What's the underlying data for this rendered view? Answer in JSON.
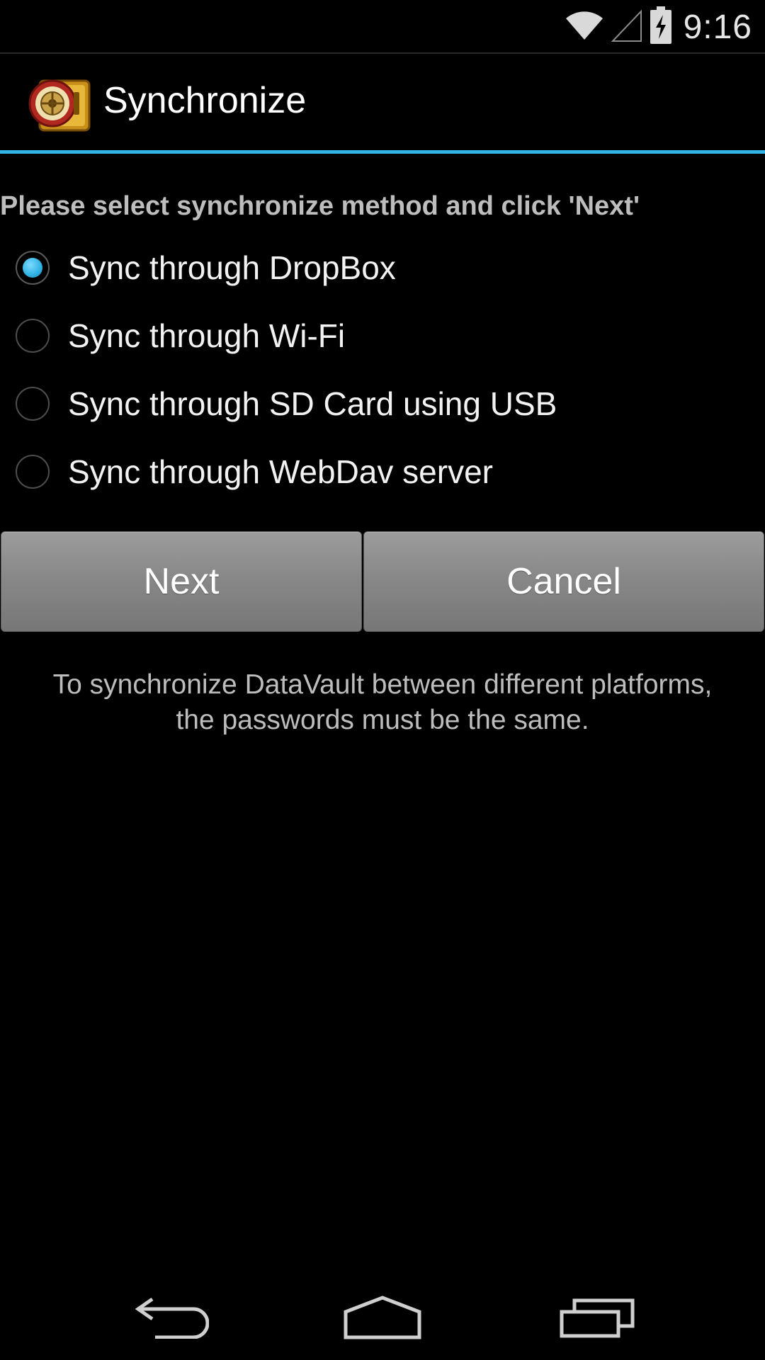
{
  "status_bar": {
    "time": "9:16",
    "icons": [
      "wifi-icon",
      "cell-signal-icon",
      "battery-charging-icon"
    ]
  },
  "action_bar": {
    "title": "Synchronize",
    "logo": "datavault-safe-logo"
  },
  "instruction": "Please select synchronize method and click 'Next'",
  "options": [
    {
      "label": "Sync through DropBox",
      "checked": true
    },
    {
      "label": "Sync through Wi-Fi",
      "checked": false
    },
    {
      "label": "Sync through SD Card using USB",
      "checked": false
    },
    {
      "label": "Sync through WebDav server",
      "checked": false
    }
  ],
  "buttons": {
    "next": "Next",
    "cancel": "Cancel"
  },
  "note": {
    "line1": "To synchronize DataVault between different platforms,",
    "line2": "the passwords must be the same."
  },
  "nav_bar": {
    "icons": [
      "back-icon",
      "home-icon",
      "recent-apps-icon"
    ]
  },
  "colors": {
    "accent": "#33b5e5",
    "background": "#000000",
    "button": "#888888"
  }
}
